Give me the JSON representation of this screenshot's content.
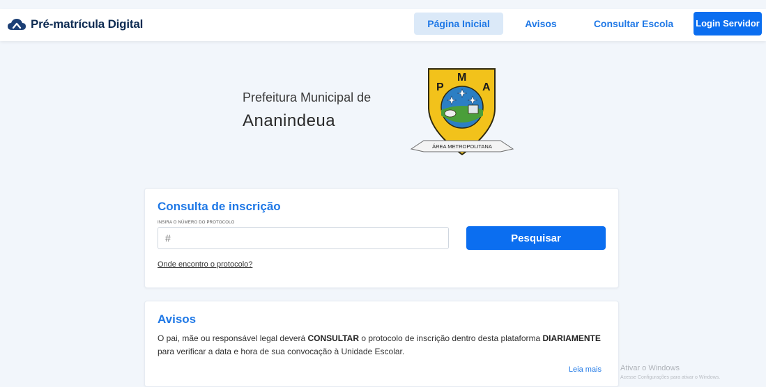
{
  "header": {
    "brand_name": "Pré-matrícula Digital",
    "brand_icon": "cloud-icon",
    "nav": {
      "home": "Página Inicial",
      "avisos": "Avisos",
      "consultar": "Consultar Escola",
      "login": "Login Servidor"
    }
  },
  "hero": {
    "line1": "Prefeitura Municipal de",
    "line2": "Ananindeua",
    "crest": {
      "letters": [
        "P",
        "M",
        "A"
      ],
      "banner": "ÁREA METROPOLITANA"
    }
  },
  "consulta": {
    "title": "Consulta de inscrição",
    "field_label": "INSIRA O NÚMERO DO PROTOCOLO",
    "placeholder": "#",
    "button": "Pesquisar",
    "help_link": "Onde encontro o protocolo?"
  },
  "avisos": {
    "title": "Avisos",
    "text_part1": "O pai, mãe ou responsável legal deverá ",
    "text_bold1": "CONSULTAR",
    "text_part2": " o protocolo de inscrição dentro desta plataforma ",
    "text_bold2": "DIARIAMENTE",
    "text_part3": " para verificar a data e hora de sua convocação à Unidade Escolar.",
    "read_more": "Leia mais"
  },
  "watermark": {
    "line1": "Ativar o Windows",
    "line2": "Acesse Configurações para ativar o Windows."
  },
  "colors": {
    "accent": "#1f78e6",
    "primary_button": "#0b6ef0",
    "brand_text": "#0d2b52",
    "background": "#f2f6fb"
  }
}
